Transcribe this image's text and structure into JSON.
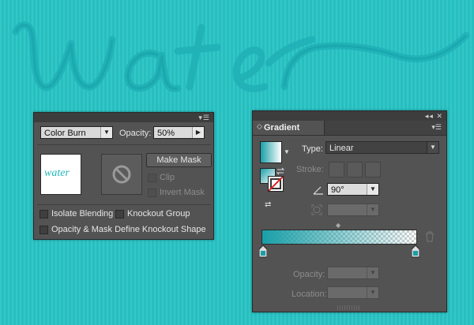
{
  "artwork": {
    "word": "water",
    "background_color": "#29c4c5",
    "text_color": "#20aab0"
  },
  "transparency_panel": {
    "panel_menu_icon": "panel-menu-icon",
    "blend_mode": "Color Burn",
    "opacity_label": "Opacity:",
    "opacity_value": "50%",
    "thumbnail_text": "water",
    "make_mask_label": "Make Mask",
    "clip_label": "Clip",
    "invert_mask_label": "Invert Mask",
    "isolate_blending_label": "Isolate Blending",
    "knockout_group_label": "Knockout Group",
    "opacity_mask_label": "Opacity & Mask Define Knockout Shape"
  },
  "gradient_panel": {
    "title": "Gradient",
    "collapse_icon": "double-chevron-left-icon",
    "close_icon": "close-icon",
    "menu_icon": "panel-menu-icon",
    "type_label": "Type:",
    "type_value": "Linear",
    "stroke_label": "Stroke:",
    "angle_value": "90°",
    "aspect_value": "",
    "opacity_label": "Opacity:",
    "opacity_value": "",
    "location_label": "Location:",
    "location_value": "",
    "gradient_start_color": "#1a9fa8",
    "gradient_end_color": "#ffffff"
  }
}
